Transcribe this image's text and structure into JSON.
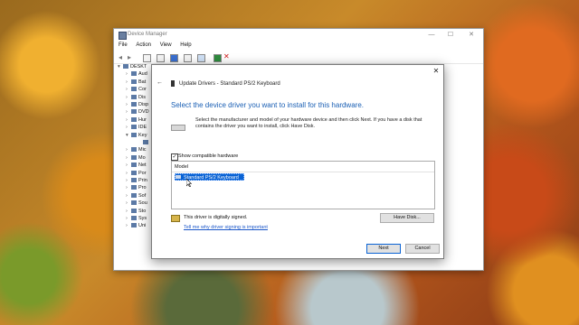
{
  "device_manager": {
    "title": "Device Manager",
    "window_controls": [
      "—",
      "☐",
      "✕"
    ],
    "menu": [
      "File",
      "Action",
      "View",
      "Help"
    ],
    "tree": [
      {
        "expander": "▾",
        "label": "DESKT",
        "root": true
      },
      {
        "expander": "›",
        "label": "Aud"
      },
      {
        "expander": "›",
        "label": "Bat"
      },
      {
        "expander": "›",
        "label": "Cor"
      },
      {
        "expander": "›",
        "label": "Dis"
      },
      {
        "expander": "›",
        "label": "Disp"
      },
      {
        "expander": "›",
        "label": "DVD"
      },
      {
        "expander": "›",
        "label": "Hur"
      },
      {
        "expander": "›",
        "label": "IDE"
      },
      {
        "expander": "▾",
        "label": "Key"
      },
      {
        "expander": "",
        "label": "",
        "child": true
      },
      {
        "expander": "›",
        "label": "Mic"
      },
      {
        "expander": "›",
        "label": "Mo"
      },
      {
        "expander": "›",
        "label": "Net"
      },
      {
        "expander": "›",
        "label": "Por"
      },
      {
        "expander": "›",
        "label": "Prin"
      },
      {
        "expander": "›",
        "label": "Pro"
      },
      {
        "expander": "›",
        "label": "Sof"
      },
      {
        "expander": "›",
        "label": "Sou"
      },
      {
        "expander": "›",
        "label": "Sto"
      },
      {
        "expander": "›",
        "label": "Sys"
      },
      {
        "expander": "›",
        "label": "Uni"
      }
    ]
  },
  "dialog": {
    "close_glyph": "✕",
    "back_glyph": "←",
    "title": "Update Drivers - Standard PS/2 Keyboard",
    "heading": "Select the device driver you want to install for this hardware.",
    "description": "Select the manufacturer and model of your hardware device and then click Next. If you have a disk that contains the driver you want to install, click Have Disk.",
    "show_compatible": {
      "label": "Show compatible hardware",
      "checked": true,
      "mark": "✓"
    },
    "model_list": {
      "header": "Model",
      "items": [
        "Standard PS/2 Keyboard"
      ],
      "selected_index": 0
    },
    "signed_text": "This driver is digitally signed.",
    "signing_link": "Tell me why driver signing is important",
    "buttons": {
      "have_disk": "Have Disk...",
      "next": "Next",
      "cancel": "Cancel"
    }
  },
  "colors": {
    "accent": "#0a63d4",
    "heading": "#1a5fb4",
    "link": "#1a56c9"
  }
}
